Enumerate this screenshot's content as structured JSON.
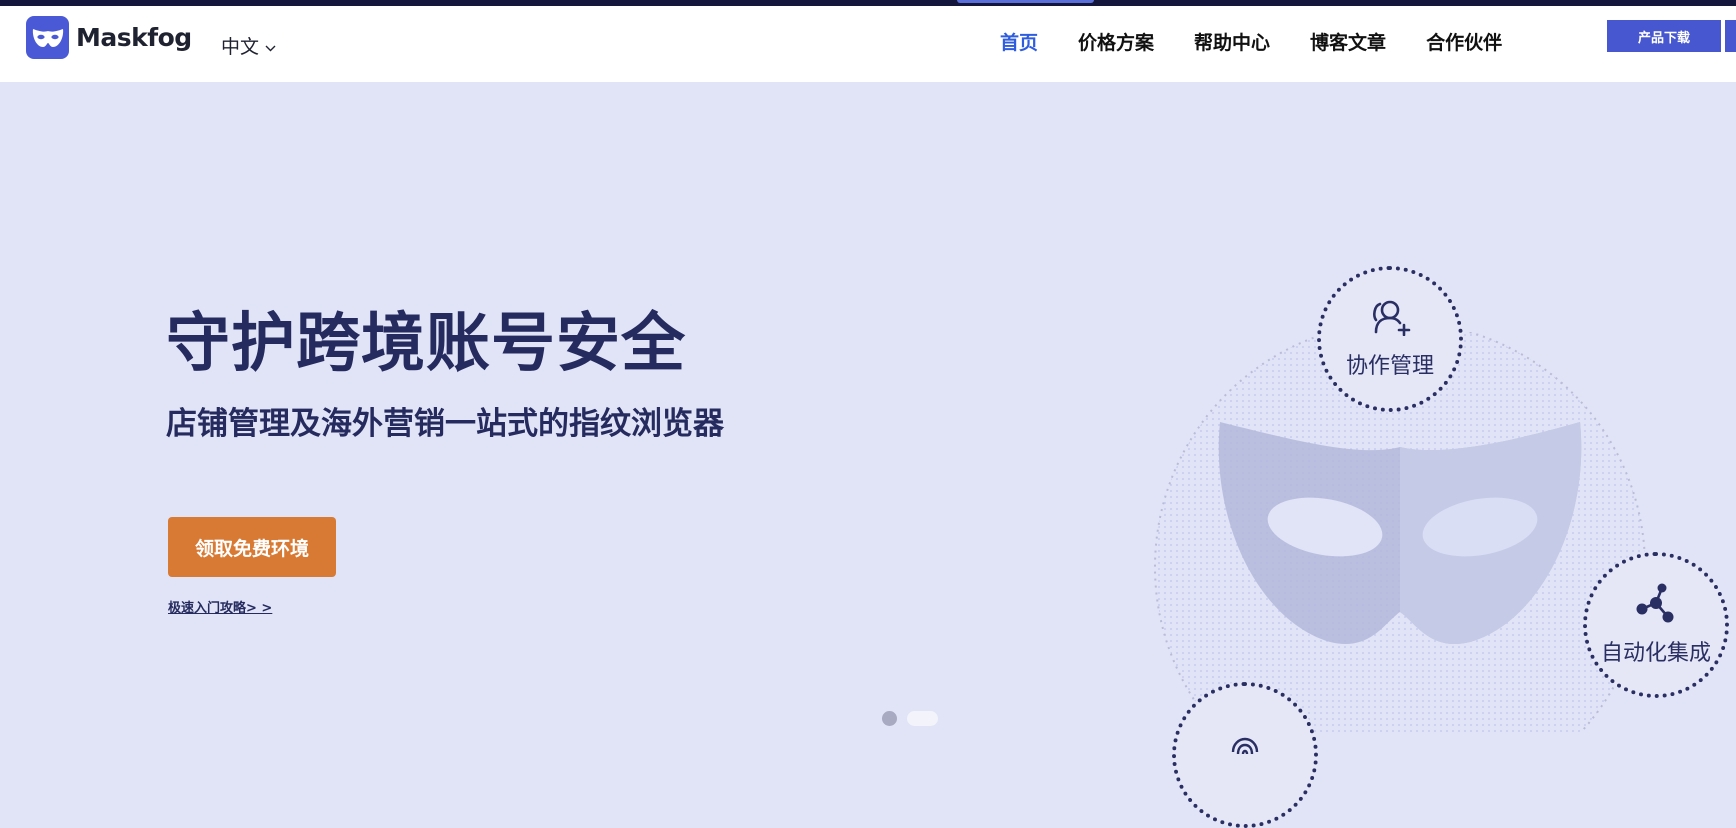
{
  "brand": {
    "name": "Maskfog",
    "logo_icon": "mask-icon",
    "color": "#4a5ad6"
  },
  "language": {
    "current": "中文",
    "icon": "chevron-down-icon"
  },
  "nav": {
    "items": [
      {
        "label": "首页",
        "active": true
      },
      {
        "label": "价格方案",
        "active": false
      },
      {
        "label": "帮助中心",
        "active": false
      },
      {
        "label": "博客文章",
        "active": false
      },
      {
        "label": "合作伙伴",
        "active": false
      }
    ],
    "download_label": "产品下载"
  },
  "hero": {
    "title": "守护跨境账号安全",
    "subtitle": "店铺管理及海外营销一站式的指纹浏览器",
    "cta_label": "领取免费环境",
    "guide_link": "极速入门攻略> >"
  },
  "features": [
    {
      "label": "协作管理",
      "icon": "user-add-icon"
    },
    {
      "label": "自动化集成",
      "icon": "share-nodes-icon"
    },
    {
      "label": "",
      "icon": "fingerprint-icon"
    }
  ],
  "carousel": {
    "slides": 2,
    "current": 1
  },
  "colors": {
    "accent": "#2f5de0",
    "cta": "#d97a34",
    "hero_bg": "#e1e4f6",
    "heading": "#252b5e"
  }
}
